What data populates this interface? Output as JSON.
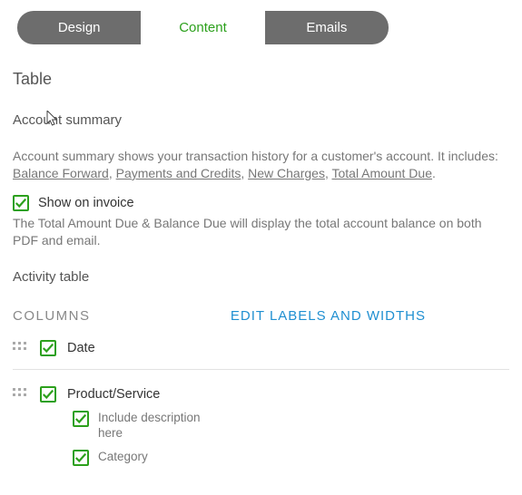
{
  "tabs": {
    "design": "Design",
    "content": "Content",
    "emails": "Emails"
  },
  "sectionTitle": "Table",
  "accountSummary": {
    "title": "Account summary",
    "desc_lead": "Account summary shows your transaction history for a customer's account. It includes: ",
    "links": {
      "balance_forward": "Balance Forward",
      "payments_credits": "Payments and Credits",
      "new_charges": "New Charges",
      "total_amount_due": "Total Amount Due"
    },
    "showOnInvoice": "Show on invoice",
    "helpText": "The Total Amount Due & Balance Due will display the total account balance on both PDF and email."
  },
  "activityTable": {
    "title": "Activity table",
    "columnsHeading": "COLUMNS",
    "editLink": "EDIT LABELS AND WIDTHS",
    "col_date": "Date",
    "col_product_service": "Product/Service",
    "sub_include_description": "Include description here",
    "sub_category": "Category"
  }
}
